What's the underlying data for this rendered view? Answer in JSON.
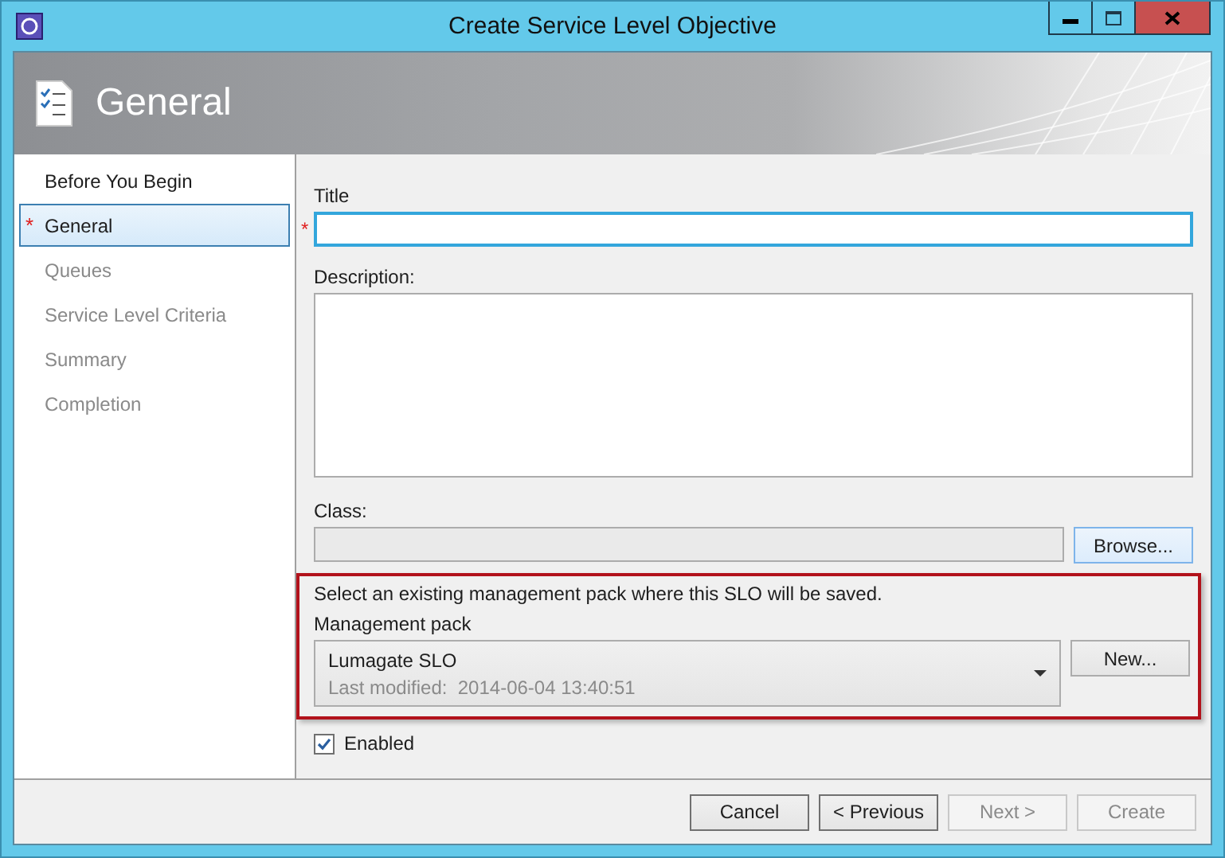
{
  "window": {
    "title": "Create Service Level Objective"
  },
  "header": {
    "title": "General"
  },
  "required_mark": "*",
  "steps": [
    {
      "label": "Before You Begin",
      "selected": false,
      "disabled": false,
      "required": false
    },
    {
      "label": "General",
      "selected": true,
      "disabled": false,
      "required": true
    },
    {
      "label": "Queues",
      "selected": false,
      "disabled": true,
      "required": false
    },
    {
      "label": "Service Level Criteria",
      "selected": false,
      "disabled": true,
      "required": false
    },
    {
      "label": "Summary",
      "selected": false,
      "disabled": true,
      "required": false
    },
    {
      "label": "Completion",
      "selected": false,
      "disabled": true,
      "required": false
    }
  ],
  "title_field": {
    "label": "Title",
    "required": true,
    "focused": true
  },
  "description_field": {
    "label": "Description:"
  },
  "class_field": {
    "label": "Class:",
    "disabled": true,
    "button": "Browse..."
  },
  "management_pack": {
    "instruction": "Select an existing management pack where this SLO will be saved.",
    "label": "Management pack",
    "name": "Lumagate SLO",
    "modified_label": "Last modified:",
    "modified": "2014-06-04 13:40:51",
    "button": "New..."
  },
  "enabled": {
    "label": "Enabled",
    "checked": true
  },
  "buttons": [
    {
      "label": "Cancel",
      "disabled": false
    },
    {
      "label": "< Previous",
      "disabled": false
    },
    {
      "label": "Next >",
      "disabled": true
    },
    {
      "label": "Create",
      "disabled": true
    }
  ]
}
